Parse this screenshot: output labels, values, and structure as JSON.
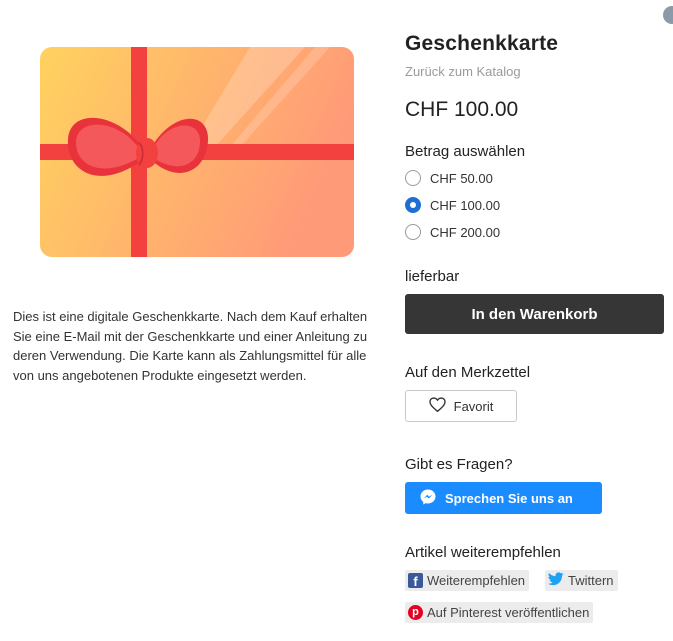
{
  "colors": {
    "accent_blue": "#1f6fd2",
    "chat_blue": "#1a8cff",
    "cart_dark": "#363636",
    "card_gradient_start": "#ffd25f",
    "card_gradient_end": "#ff9a78",
    "ribbon": "#f2413f",
    "facebook": "#3b5998",
    "twitter": "#1da1f2",
    "pinterest": "#e60023"
  },
  "product": {
    "image_icon": "gift-card-image",
    "description": "Dies ist eine digitale Geschenkkarte. Nach dem Kauf erhalten Sie eine E-Mail mit der Geschenkkarte und einer Anleitung zu deren Verwendung. Die Karte kann als Zahlungsmittel für alle von uns angebotenen Produkte eingesetzt werden.",
    "title": "Geschenkkarte",
    "back_link": "Zurück zum Katalog",
    "price": "CHF 100.00"
  },
  "amount": {
    "label": "Betrag auswählen",
    "options": [
      {
        "label": "CHF 50.00",
        "selected": false
      },
      {
        "label": "CHF 100.00",
        "selected": true
      },
      {
        "label": "CHF 200.00",
        "selected": false
      }
    ]
  },
  "availability": "lieferbar",
  "cart": {
    "button_label": "In den Warenkorb"
  },
  "wishlist": {
    "label": "Auf den Merkzettel",
    "button_label": "Favorit",
    "icon": "heart-icon"
  },
  "questions": {
    "label": "Gibt es Fragen?",
    "button_label": "Sprechen Sie uns an",
    "icon": "messenger-icon"
  },
  "share": {
    "label": "Artikel weiterempfehlen",
    "facebook_label": "Weiterempfehlen",
    "twitter_label": "Twittern",
    "pinterest_label": "Auf Pinterest veröffentlichen",
    "facebook_icon": "facebook-icon",
    "twitter_icon": "twitter-icon",
    "pinterest_icon": "pinterest-icon"
  }
}
